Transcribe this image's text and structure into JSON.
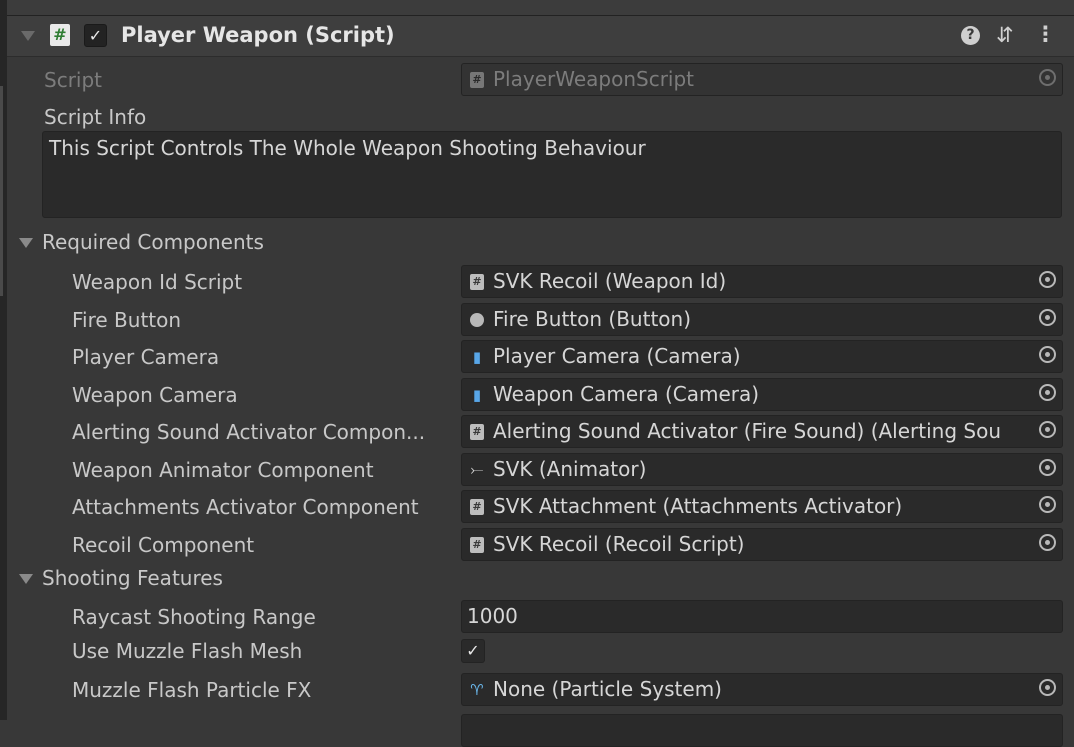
{
  "component": {
    "title": "Player Weapon (Script)",
    "script_icon": "#",
    "enabled_check": "✓",
    "help_icon": "?",
    "preset_icon": "⇵",
    "menu_icon": "⋮"
  },
  "script_field": {
    "label": "Script",
    "value": "PlayerWeaponScript"
  },
  "script_info": {
    "label": "Script Info",
    "text": "This Script Controls The Whole Weapon Shooting Behaviour"
  },
  "required_components": {
    "header": "Required Components",
    "rows": [
      {
        "label": "Weapon Id Script",
        "value": "SVK Recoil (Weapon Id)",
        "icon": "script-icon"
      },
      {
        "label": "Fire Button",
        "value": "Fire Button (Button)",
        "icon": "button-icon"
      },
      {
        "label": "Player Camera",
        "value": "Player Camera (Camera)",
        "icon": "camera-icon"
      },
      {
        "label": "Weapon Camera",
        "value": "Weapon Camera (Camera)",
        "icon": "camera-icon"
      },
      {
        "label": "Alerting Sound Activator Compon...",
        "value": "Alerting Sound Activator (Fire Sound) (Alerting Sou",
        "icon": "script-icon"
      },
      {
        "label": "Weapon Animator Component",
        "value": "SVK (Animator)",
        "icon": "animator-icon"
      },
      {
        "label": "Attachments Activator Component",
        "value": "SVK Attachment (Attachments Activator)",
        "icon": "script-icon"
      },
      {
        "label": "Recoil Component",
        "value": "SVK Recoil (Recoil Script)",
        "icon": "script-icon"
      }
    ]
  },
  "shooting_features": {
    "header": "Shooting Features",
    "raycast_range": {
      "label": "Raycast Shooting Range",
      "value": "1000"
    },
    "use_muzzle_mesh": {
      "label": "Use Muzzle Flash Mesh",
      "checked": true,
      "check_glyph": "✓"
    },
    "muzzle_particle": {
      "label": "Muzzle Flash Particle FX",
      "value": "None (Particle System)",
      "icon": "particle-icon"
    }
  },
  "colors": {
    "background": "#383838",
    "field": "#2a2a2a",
    "camera_icon": "#58a6e8",
    "script_badge": "#2e7d32"
  }
}
